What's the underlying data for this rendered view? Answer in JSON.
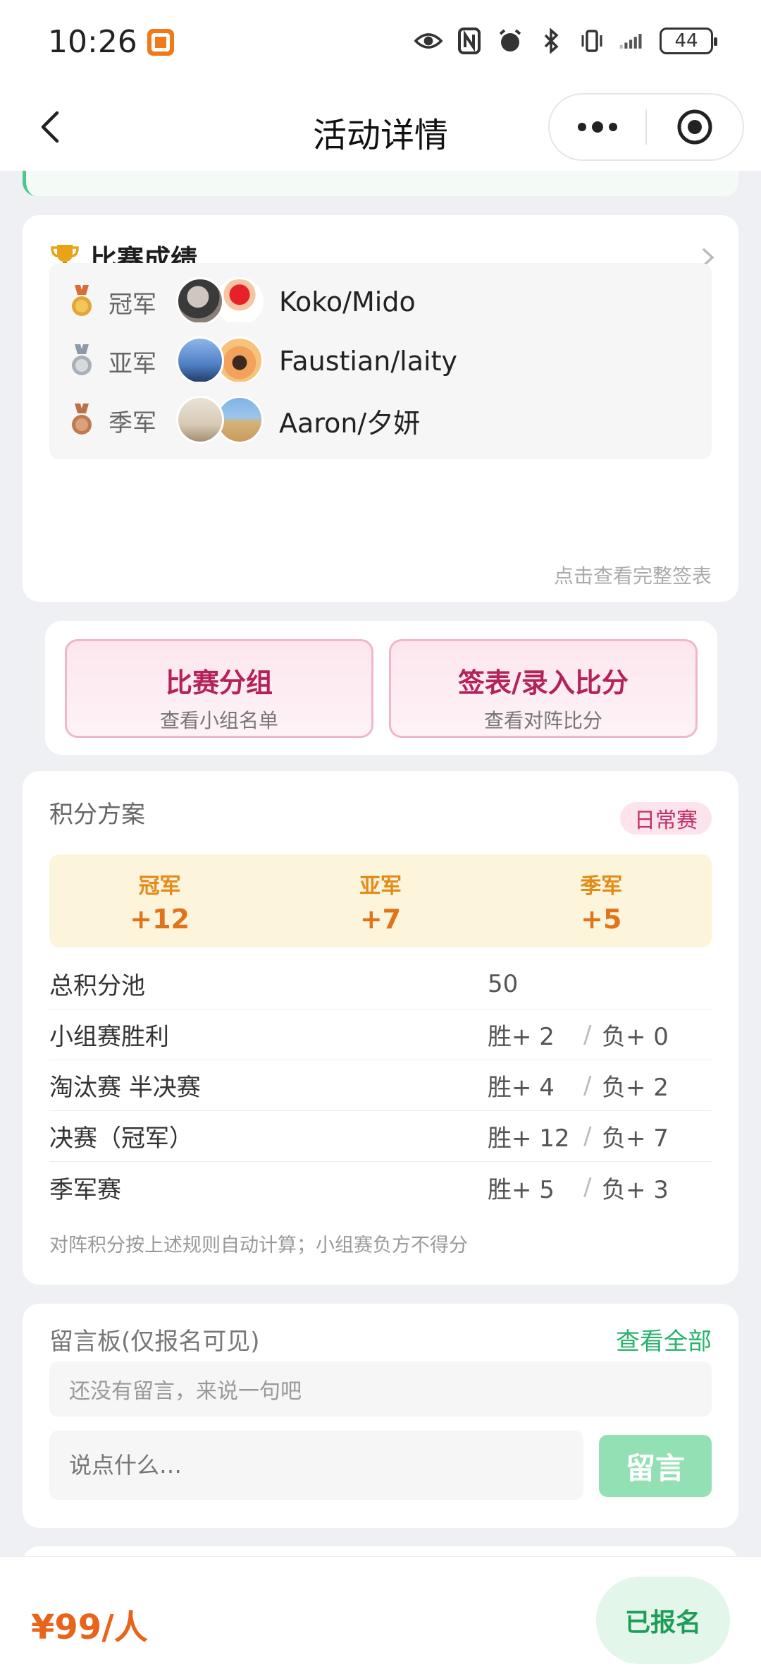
{
  "status_bar": {
    "time": "10:26",
    "battery": "44"
  },
  "nav": {
    "title": "活动详情"
  },
  "results": {
    "title": "比赛成绩",
    "rows": [
      {
        "rank": "冠军",
        "names": "Koko/Mido",
        "medal_color": "#d49a3a"
      },
      {
        "rank": "亚军",
        "names": "Faustian/laity",
        "medal_color": "#9aa0a6"
      },
      {
        "rank": "季军",
        "names": "Aaron/夕妍",
        "medal_color": "#b8734a"
      }
    ],
    "view_full_sheet": "点击查看完整签表"
  },
  "actions": {
    "group": {
      "title": "比赛分组",
      "subtitle": "查看小组名单"
    },
    "sheet": {
      "title": "签表/录入比分",
      "subtitle": "查看对阵比分"
    }
  },
  "points": {
    "title": "积分方案",
    "tag": "日常赛",
    "prizes": [
      {
        "label": "冠军",
        "value": "+12"
      },
      {
        "label": "亚军",
        "value": "+7"
      },
      {
        "label": "季军",
        "value": "+5"
      }
    ],
    "pool": {
      "label": "总积分池",
      "value": "50"
    },
    "rules": [
      {
        "name": "小组赛胜利",
        "win": "胜+ 2",
        "sep": "/",
        "lose": "负+ 0"
      },
      {
        "name": "淘汰赛 半决赛",
        "win": "胜+ 4",
        "sep": "/",
        "lose": "负+ 2"
      },
      {
        "name": "决赛（冠军）",
        "win": "胜+ 12",
        "sep": "/",
        "lose": "负+ 7"
      },
      {
        "name": "季军赛",
        "win": "胜+ 5",
        "sep": "/",
        "lose": "负+ 3"
      }
    ],
    "note": "对阵积分按上述规则自动计算；小组赛负方不得分"
  },
  "board": {
    "title": "留言板(仅报名可见)",
    "view_all": "查看全部",
    "empty": "还没有留言，来说一句吧",
    "input_placeholder": "说点什么…",
    "submit": "留言"
  },
  "footer": {
    "price": "¥99/人",
    "status_button": "已报名"
  },
  "colors": {
    "accent_green": "#27b36b",
    "accent_pink": "#b3235a",
    "accent_orange": "#e8641a"
  }
}
